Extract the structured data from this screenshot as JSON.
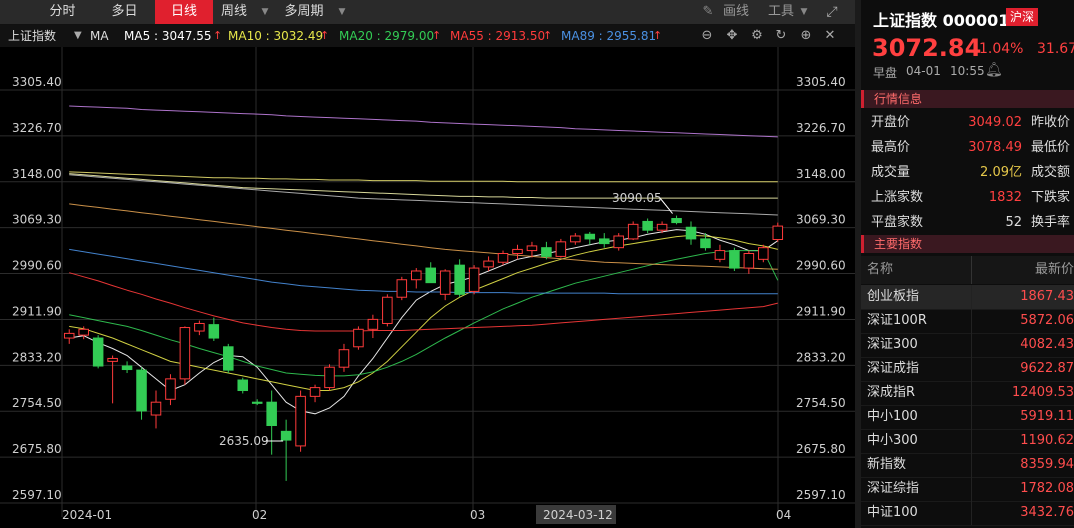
{
  "toolbar": {
    "tabs": [
      "分时",
      "多日",
      "日线",
      "周线",
      "多周期"
    ],
    "active_tab": "日线",
    "draw_label": "画线",
    "tools_label": "工具"
  },
  "ma_bar": {
    "symbol": "上证指数",
    "ma_label": "MA",
    "ma5": "MA5 : 3047.55",
    "ma10": "MA10 : 3032.49",
    "ma20": "MA20 : 2979.00",
    "ma55": "MA55 : 2913.50",
    "ma89": "MA89 : 2955.81",
    "colors": {
      "ma5": "#ffffff",
      "ma10": "#e6e64a",
      "ma20": "#33cc55",
      "ma55": "#ff3b3b",
      "ma89": "#4a90e2",
      "ma120": "#c080e0",
      "ma250": "#e0a050"
    }
  },
  "chart": {
    "y_ticks": [
      "3305.40",
      "3226.70",
      "3148.00",
      "3069.30",
      "2990.60",
      "2911.90",
      "2833.20",
      "2754.50",
      "2675.80",
      "2597.10"
    ],
    "x_labels": [
      "2024-01",
      "02",
      "03",
      "04"
    ],
    "cursor_date": "2024-03-12",
    "annot_high": "3090.05",
    "annot_low": "2635.09"
  },
  "chart_data": {
    "type": "candlestick",
    "title": "上证指数",
    "ylim": [
      2597.1,
      3305.4
    ],
    "up_color": "#ff3b3b",
    "down_color": "#33cc55",
    "candles": [
      {
        "o": 2880,
        "h": 2895,
        "l": 2870,
        "c": 2888
      },
      {
        "o": 2885,
        "h": 2900,
        "l": 2878,
        "c": 2895
      },
      {
        "o": 2880,
        "h": 2885,
        "l": 2828,
        "c": 2832
      },
      {
        "o": 2840,
        "h": 2850,
        "l": 2768,
        "c": 2845
      },
      {
        "o": 2832,
        "h": 2840,
        "l": 2820,
        "c": 2826
      },
      {
        "o": 2825,
        "h": 2830,
        "l": 2740,
        "c": 2755
      },
      {
        "o": 2748,
        "h": 2790,
        "l": 2725,
        "c": 2770
      },
      {
        "o": 2775,
        "h": 2818,
        "l": 2765,
        "c": 2810
      },
      {
        "o": 2810,
        "h": 2900,
        "l": 2800,
        "c": 2898
      },
      {
        "o": 2892,
        "h": 2910,
        "l": 2885,
        "c": 2905
      },
      {
        "o": 2903,
        "h": 2915,
        "l": 2875,
        "c": 2880
      },
      {
        "o": 2865,
        "h": 2870,
        "l": 2820,
        "c": 2825
      },
      {
        "o": 2808,
        "h": 2812,
        "l": 2785,
        "c": 2790
      },
      {
        "o": 2770,
        "h": 2775,
        "l": 2765,
        "c": 2768
      },
      {
        "o": 2770,
        "h": 2790,
        "l": 2680,
        "c": 2730
      },
      {
        "o": 2720,
        "h": 2740,
        "l": 2635,
        "c": 2705
      },
      {
        "o": 2695,
        "h": 2790,
        "l": 2685,
        "c": 2780
      },
      {
        "o": 2780,
        "h": 2800,
        "l": 2770,
        "c": 2795
      },
      {
        "o": 2795,
        "h": 2835,
        "l": 2790,
        "c": 2830
      },
      {
        "o": 2830,
        "h": 2870,
        "l": 2822,
        "c": 2860
      },
      {
        "o": 2865,
        "h": 2900,
        "l": 2860,
        "c": 2895
      },
      {
        "o": 2895,
        "h": 2920,
        "l": 2880,
        "c": 2912
      },
      {
        "o": 2905,
        "h": 2955,
        "l": 2900,
        "c": 2950
      },
      {
        "o": 2950,
        "h": 2985,
        "l": 2945,
        "c": 2980
      },
      {
        "o": 2980,
        "h": 3000,
        "l": 2965,
        "c": 2995
      },
      {
        "o": 3000,
        "h": 3010,
        "l": 2988,
        "c": 2975
      },
      {
        "o": 2955,
        "h": 2998,
        "l": 2945,
        "c": 2995
      },
      {
        "o": 3005,
        "h": 3015,
        "l": 2950,
        "c": 2955
      },
      {
        "o": 2960,
        "h": 3005,
        "l": 2955,
        "c": 3000
      },
      {
        "o": 3002,
        "h": 3020,
        "l": 2995,
        "c": 3012
      },
      {
        "o": 3010,
        "h": 3030,
        "l": 3005,
        "c": 3025
      },
      {
        "o": 3025,
        "h": 3040,
        "l": 3015,
        "c": 3032
      },
      {
        "o": 3030,
        "h": 3045,
        "l": 3018,
        "c": 3038
      },
      {
        "o": 3035,
        "h": 3045,
        "l": 3015,
        "c": 3020
      },
      {
        "o": 3020,
        "h": 3050,
        "l": 3018,
        "c": 3045
      },
      {
        "o": 3045,
        "h": 3060,
        "l": 3040,
        "c": 3055
      },
      {
        "o": 3058,
        "h": 3062,
        "l": 3040,
        "c": 3050
      },
      {
        "o": 3050,
        "h": 3060,
        "l": 3035,
        "c": 3042
      },
      {
        "o": 3035,
        "h": 3060,
        "l": 3030,
        "c": 3055
      },
      {
        "o": 3050,
        "h": 3080,
        "l": 3048,
        "c": 3075
      },
      {
        "o": 3080,
        "h": 3085,
        "l": 3060,
        "c": 3065
      },
      {
        "o": 3065,
        "h": 3080,
        "l": 3060,
        "c": 3075
      },
      {
        "o": 3085,
        "h": 3090,
        "l": 3075,
        "c": 3078
      },
      {
        "o": 3070,
        "h": 3080,
        "l": 3040,
        "c": 3050
      },
      {
        "o": 3050,
        "h": 3060,
        "l": 3030,
        "c": 3035
      },
      {
        "o": 3015,
        "h": 3040,
        "l": 3010,
        "c": 3030
      },
      {
        "o": 3030,
        "h": 3035,
        "l": 2995,
        "c": 3000
      },
      {
        "o": 3000,
        "h": 3030,
        "l": 2990,
        "c": 3025
      },
      {
        "o": 3015,
        "h": 3040,
        "l": 3010,
        "c": 3035
      },
      {
        "o": 3049,
        "h": 3078,
        "l": 3045,
        "c": 3072
      }
    ],
    "ma_lines": [
      {
        "name": "MA5",
        "color": "#ffffff",
        "values": [
          2880,
          2884,
          2872,
          2862,
          2850,
          2830,
          2810,
          2790,
          2800,
          2820,
          2838,
          2850,
          2848,
          2830,
          2800,
          2770,
          2755,
          2750,
          2760,
          2780,
          2815,
          2845,
          2880,
          2915,
          2945,
          2960,
          2972,
          2978,
          2985,
          2995,
          3005,
          3015,
          3020,
          3025,
          3030,
          3035,
          3040,
          3045,
          3048,
          3052,
          3058,
          3062,
          3066,
          3064,
          3058,
          3048,
          3040,
          3030,
          3030,
          3047
        ]
      },
      {
        "name": "MA10",
        "color": "#e6e64a",
        "values": [
          2900,
          2896,
          2888,
          2880,
          2870,
          2860,
          2850,
          2840,
          2835,
          2830,
          2825,
          2820,
          2815,
          2810,
          2805,
          2800,
          2795,
          2790,
          2790,
          2795,
          2805,
          2820,
          2840,
          2865,
          2890,
          2915,
          2935,
          2950,
          2962,
          2972,
          2982,
          2992,
          3000,
          3008,
          3015,
          3022,
          3028,
          3033,
          3038,
          3042,
          3046,
          3050,
          3054,
          3056,
          3055,
          3052,
          3048,
          3042,
          3038,
          3032
        ]
      },
      {
        "name": "MA20",
        "color": "#33cc55",
        "values": [
          2920,
          2915,
          2910,
          2905,
          2900,
          2893,
          2885,
          2877,
          2870,
          2862,
          2855,
          2848,
          2840,
          2832,
          2826,
          2820,
          2818,
          2816,
          2815,
          2815,
          2817,
          2822,
          2830,
          2840,
          2852,
          2866,
          2880,
          2893,
          2906,
          2918,
          2930,
          2940,
          2950,
          2958,
          2966,
          2974,
          2980,
          2986,
          2992,
          2998,
          3004,
          3010,
          3015,
          3020,
          3025,
          3028,
          3030,
          3030,
          3030,
          2979
        ]
      },
      {
        "name": "MA55",
        "color": "#ff3b3b",
        "values": [
          2992,
          2985,
          2978,
          2970,
          2962,
          2955,
          2947,
          2940,
          2932,
          2925,
          2918,
          2912,
          2906,
          2902,
          2898,
          2895,
          2893,
          2892,
          2892,
          2892,
          2892,
          2893,
          2893,
          2893,
          2894,
          2895,
          2896,
          2897,
          2898,
          2899,
          2900,
          2901,
          2902,
          2904,
          2906,
          2908,
          2910,
          2912,
          2914,
          2916,
          2918,
          2920,
          2922,
          2924,
          2926,
          2928,
          2930,
          2932,
          2934,
          2940
        ]
      },
      {
        "name": "MA89",
        "color": "#4a90e2",
        "values": [
          3032,
          3028,
          3024,
          3020,
          3016,
          3012,
          3008,
          3004,
          3000,
          2996,
          2992,
          2988,
          2984,
          2980,
          2976,
          2973,
          2970,
          2968,
          2966,
          2964,
          2962,
          2961,
          2960,
          2960,
          2959,
          2959,
          2959,
          2958,
          2958,
          2958,
          2958,
          2957,
          2957,
          2957,
          2957,
          2957,
          2957,
          2957,
          2956,
          2956,
          2956,
          2956,
          2956,
          2956,
          2956,
          2956,
          2956,
          2956,
          2956,
          2956
        ]
      },
      {
        "name": "MA120",
        "color": "#c080e0",
        "values": [
          3278,
          3277,
          3276,
          3275,
          3274,
          3272,
          3271,
          3270,
          3269,
          3268,
          3267,
          3266,
          3265,
          3264,
          3263,
          3261,
          3260,
          3259,
          3258,
          3257,
          3256,
          3255,
          3254,
          3253,
          3252,
          3250,
          3249,
          3248,
          3247,
          3246,
          3245,
          3244,
          3243,
          3242,
          3241,
          3239,
          3238,
          3237,
          3236,
          3235,
          3234,
          3233,
          3232,
          3231,
          3230,
          3229,
          3228,
          3227,
          3226,
          3225
        ]
      },
      {
        "name": "MA250",
        "color": "#e0a050",
        "values": [
          3110,
          3107,
          3104,
          3101,
          3098,
          3095,
          3092,
          3089,
          3086,
          3083,
          3080,
          3077,
          3074,
          3071,
          3068,
          3065,
          3062,
          3059,
          3056,
          3053,
          3050,
          3047,
          3044,
          3041,
          3038,
          3035,
          3032,
          3030,
          3028,
          3026,
          3024,
          3022,
          3020,
          3018,
          3016,
          3014,
          3012,
          3010,
          3009,
          3008,
          3007,
          3006,
          3005,
          3004,
          3003,
          3002,
          3001,
          3000,
          2999,
          2998
        ]
      },
      {
        "name": "",
        "color": "#e8e070",
        "values": [
          3165,
          3164,
          3163,
          3162,
          3161,
          3160,
          3159,
          3158,
          3157,
          3156,
          3155,
          3155,
          3154,
          3154,
          3153,
          3153,
          3152,
          3152,
          3151,
          3151,
          3151,
          3150,
          3150,
          3150,
          3150,
          3149,
          3149,
          3149,
          3149,
          3149,
          3149,
          3148,
          3148,
          3148,
          3148,
          3148,
          3148,
          3148,
          3148,
          3148,
          3148,
          3148,
          3148,
          3148,
          3148,
          3148,
          3148,
          3148,
          3148,
          3148
        ]
      },
      {
        "name": "",
        "color": "#bbbbbb",
        "values": [
          3160,
          3158,
          3156,
          3154,
          3152,
          3150,
          3148,
          3146,
          3144,
          3142,
          3140,
          3138,
          3136,
          3134,
          3132,
          3130,
          3128,
          3126,
          3124,
          3122,
          3120,
          3119,
          3118,
          3117,
          3116,
          3115,
          3114,
          3113,
          3112,
          3111,
          3110,
          3109,
          3108,
          3107,
          3106,
          3105,
          3104,
          3103,
          3102,
          3101,
          3100,
          3099,
          3098,
          3097,
          3096,
          3095,
          3094,
          3093,
          3092,
          3091
        ]
      },
      {
        "name": "",
        "color": "#eeeeaa",
        "values": [
          3162,
          3160,
          3158,
          3156,
          3154,
          3152,
          3150,
          3148,
          3146,
          3144,
          3142,
          3140,
          3138,
          3137,
          3136,
          3135,
          3134,
          3133,
          3132,
          3131,
          3130,
          3129,
          3128,
          3127,
          3126,
          3125,
          3124,
          3123,
          3123,
          3122,
          3122,
          3121,
          3121,
          3120,
          3120,
          3120,
          3120,
          3120,
          3120,
          3120,
          3120,
          3120,
          3120,
          3120,
          3120,
          3120,
          3120,
          3120,
          3120,
          3120
        ]
      }
    ]
  },
  "quote": {
    "name": "上证指数",
    "code": "000001",
    "market_badge": "沪深",
    "price": "3072.84",
    "change_pct": "1.04%",
    "change": "31.67",
    "session": "早盘",
    "date": "04-01",
    "time": "10:55"
  },
  "market_info": {
    "section_title": "行情信息",
    "rows": [
      {
        "k": "开盘价",
        "v": "3049.02",
        "k2": "昨收价",
        "color": "red"
      },
      {
        "k": "最高价",
        "v": "3078.49",
        "k2": "最低价",
        "color": "red"
      },
      {
        "k": "成交量",
        "v": "2.09亿",
        "k2": "成交额",
        "color": "yellow"
      },
      {
        "k": "上涨家数",
        "v": "1832",
        "k2": "下跌家",
        "color": "red"
      },
      {
        "k": "平盘家数",
        "v": "52",
        "k2": "换手率",
        "color": "white"
      }
    ]
  },
  "indices": {
    "section_title": "主要指数",
    "col_name": "名称",
    "col_price": "最新价",
    "rows": [
      {
        "n": "创业板指",
        "p": "1867.43"
      },
      {
        "n": "深证100R",
        "p": "5872.06"
      },
      {
        "n": "深证300",
        "p": "4082.43"
      },
      {
        "n": "深证成指",
        "p": "9622.87"
      },
      {
        "n": "深成指R",
        "p": "12409.53"
      },
      {
        "n": "中小100",
        "p": "5919.11"
      },
      {
        "n": "中小300",
        "p": "1190.62"
      },
      {
        "n": "新指数",
        "p": "8359.94"
      },
      {
        "n": "深证综指",
        "p": "1782.08"
      },
      {
        "n": "中证100",
        "p": "3432.76"
      }
    ]
  }
}
